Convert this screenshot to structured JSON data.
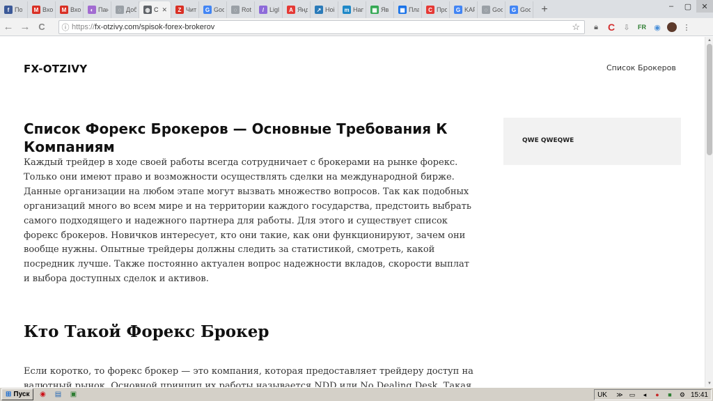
{
  "browser": {
    "tabs": [
      {
        "label": "По",
        "icon": "facebook-icon",
        "color": "#3b5998",
        "glyph": "f"
      },
      {
        "label": "Вхо",
        "icon": "gmail-icon",
        "color": "#d93025",
        "glyph": "M"
      },
      {
        "label": "Вхо",
        "icon": "gmail-icon",
        "color": "#d93025",
        "glyph": "M"
      },
      {
        "label": "Пан",
        "icon": "panel-icon",
        "color": "#a26bd1",
        "glyph": "◐"
      },
      {
        "label": "Доб",
        "icon": "loading-icon",
        "color": "#9aa0a6",
        "glyph": "◌"
      },
      {
        "label": "С",
        "icon": "globe-icon",
        "color": "#5f6368",
        "glyph": "◍",
        "active": true
      },
      {
        "label": "Чит",
        "icon": "reader-icon",
        "color": "#d93025",
        "glyph": "Z"
      },
      {
        "label": "Goo",
        "icon": "google-icon",
        "color": "#4285f4",
        "glyph": "G"
      },
      {
        "label": "Rot",
        "icon": "loading-icon",
        "color": "#9aa0a6",
        "glyph": "◌"
      },
      {
        "label": "Ligl",
        "icon": "light-icon",
        "color": "#8e6bd9",
        "glyph": "/"
      },
      {
        "label": "Янд",
        "icon": "yandex-icon",
        "color": "#e53935",
        "glyph": "A"
      },
      {
        "label": "Ноі",
        "icon": "chart-icon",
        "color": "#2b7bb9",
        "glyph": "↗"
      },
      {
        "label": "Нап",
        "icon": "m-icon",
        "color": "#1e88c7",
        "glyph": "m"
      },
      {
        "label": "Яв",
        "icon": "sheet-icon",
        "color": "#34a853",
        "glyph": "▦"
      },
      {
        "label": "Пла",
        "icon": "grid-icon",
        "color": "#1a73e8",
        "glyph": "▦"
      },
      {
        "label": "Про",
        "icon": "c-icon",
        "color": "#e53935",
        "glyph": "C"
      },
      {
        "label": "KAF",
        "icon": "google-icon",
        "color": "#4285f4",
        "glyph": "G"
      },
      {
        "label": "Goo",
        "icon": "loading-icon",
        "color": "#9aa0a6",
        "glyph": "◌"
      },
      {
        "label": "Goo",
        "icon": "translate-icon",
        "color": "#4285f4",
        "glyph": "G"
      }
    ],
    "new_tab": "+",
    "back": "←",
    "forward": "→",
    "reload": "C",
    "url_scheme": "https://",
    "url_rest": "fx-otzivy.com/spisok-forex-brokerov"
  },
  "page": {
    "site_title": "FX-OTZIVY",
    "nav_link": "Список Брокеров",
    "heading": "Список Форекс Брокеров — Основные Требования К Компаниям",
    "intro": "Каждый трейдер в ходе своей работы всегда сотрудничает с брокерами на рынке форекс. Только они имеют право и возможности осуществлять сделки на международной бирже. Данные организации на любом этапе могут вызвать множество вопросов. Так как подобных организаций много во всем мире и на территории каждого государства, предстоить выбрать самого подходящего и надежного партнера для работы. Для этого и существует список форекс брокеров. Новичков интересует, кто они такие, как они функционируют, зачем они вообще нужны. Опытные трейдеры должны следить за статистикой, смотреть, какой посредник лучше. Также постоянно актуален вопрос надежности вкладов, скорости выплат и выбора доступных сделок и активов.",
    "subheading": "Кто Такой Форекс Брокер",
    "para2": "Если коротко, то форекс брокер — это компания, которая предоставляет трейдеру доступ на валютный рынок. Основной принцип их работы называется NDD или No Dealing Desk. Такая",
    "widget_title": "QWE QWEQWE"
  },
  "taskbar": {
    "start_label": "Пуск",
    "lang": "UK",
    "clock": "15:41"
  }
}
